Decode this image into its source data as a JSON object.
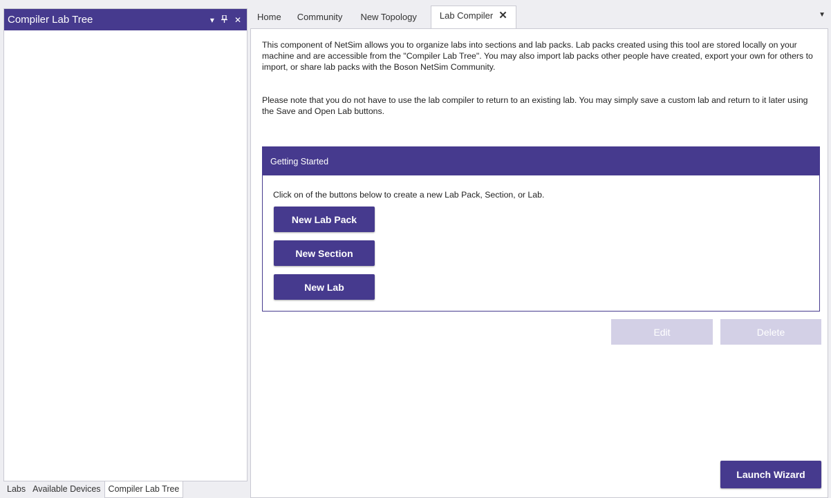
{
  "left_panel": {
    "title": "Compiler Lab Tree",
    "controls": {
      "dropdown": "▾",
      "pin": "⊥",
      "close": "✕"
    }
  },
  "bottom_tabs": [
    {
      "label": "Labs",
      "active": false
    },
    {
      "label": "Available Devices",
      "active": false
    },
    {
      "label": "Compiler Lab Tree",
      "active": true
    }
  ],
  "tabs": [
    {
      "label": "Home"
    },
    {
      "label": "Community"
    },
    {
      "label": "New Topology"
    },
    {
      "label": "Lab Compiler",
      "active": true,
      "close": "✕"
    }
  ],
  "tab_menu": "▼",
  "content": {
    "intro": "This component of NetSim allows you to organize labs into sections and lab packs. Lab packs created using this tool are stored locally on your machine and are accessible from the \"Compiler Lab Tree\". You may also import lab packs other people have created, export your own for others to import, or share lab packs with the Boson NetSim Community.",
    "note": "Please note that you do not have to use the lab compiler to return to an existing lab. You may simply save a custom lab and return to it later using the Save and Open Lab buttons.",
    "getting_started": {
      "title": "Getting Started",
      "text": "Click on of the buttons below to create a new Lab Pack, Section, or Lab.",
      "buttons": {
        "new_lab_pack": "New Lab Pack",
        "new_section": "New Section",
        "new_lab": "New Lab"
      }
    },
    "edit_label": "Edit",
    "delete_label": "Delete",
    "launch_wizard_label": "Launch Wizard"
  },
  "colors": {
    "accent": "#463a8e",
    "disabled": "#d3d0e6",
    "background": "#eeeef2"
  }
}
